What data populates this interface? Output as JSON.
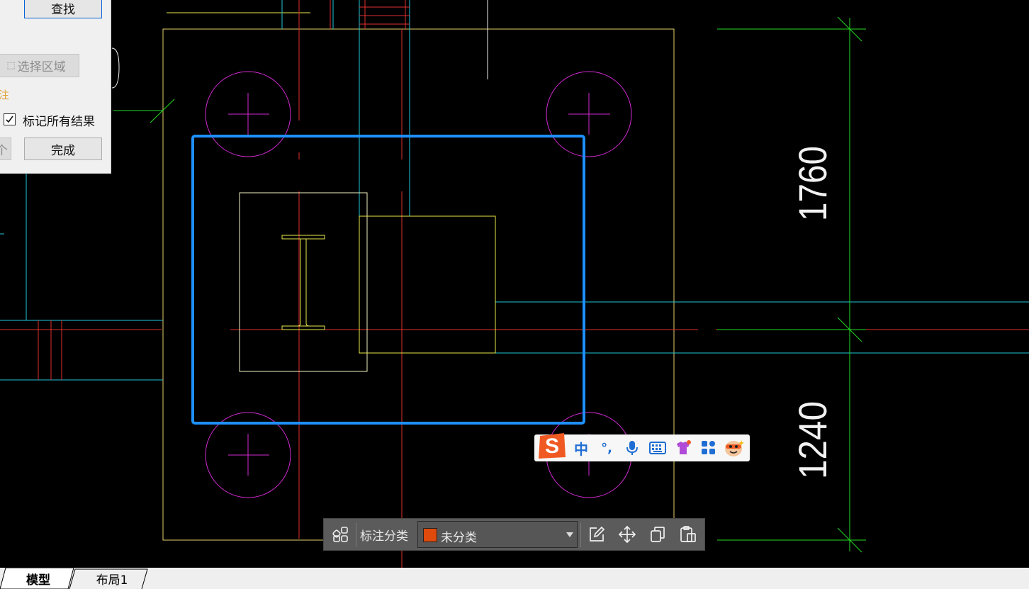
{
  "find_panel": {
    "find_button": "查找",
    "select_region_button": "选择区域",
    "annotation_section": "注",
    "mark_all_label": "标记所有结果",
    "mark_all_checked": true,
    "count_button": "个",
    "done_button": "完成"
  },
  "drawing": {
    "dimension_top": "1760",
    "dimension_bottom": "1240",
    "selection_color": "#1e90ff"
  },
  "ime_bar": {
    "logo_letter": "S",
    "mode": "中",
    "punctuation": "°,",
    "icons": [
      "microphone-icon",
      "keyboard-icon",
      "skin-icon",
      "apps-icon",
      "mascot-icon"
    ]
  },
  "annotation_toolbar": {
    "category_label": "标注分类",
    "category_value": "未分类",
    "category_color": "#e04a0c",
    "icons": [
      "grid-icon",
      "edit-icon",
      "move-icon",
      "copy-icon",
      "paste-icon"
    ]
  },
  "tabs": [
    {
      "label": "模型",
      "active": true
    },
    {
      "label": "布局1",
      "active": false
    }
  ]
}
